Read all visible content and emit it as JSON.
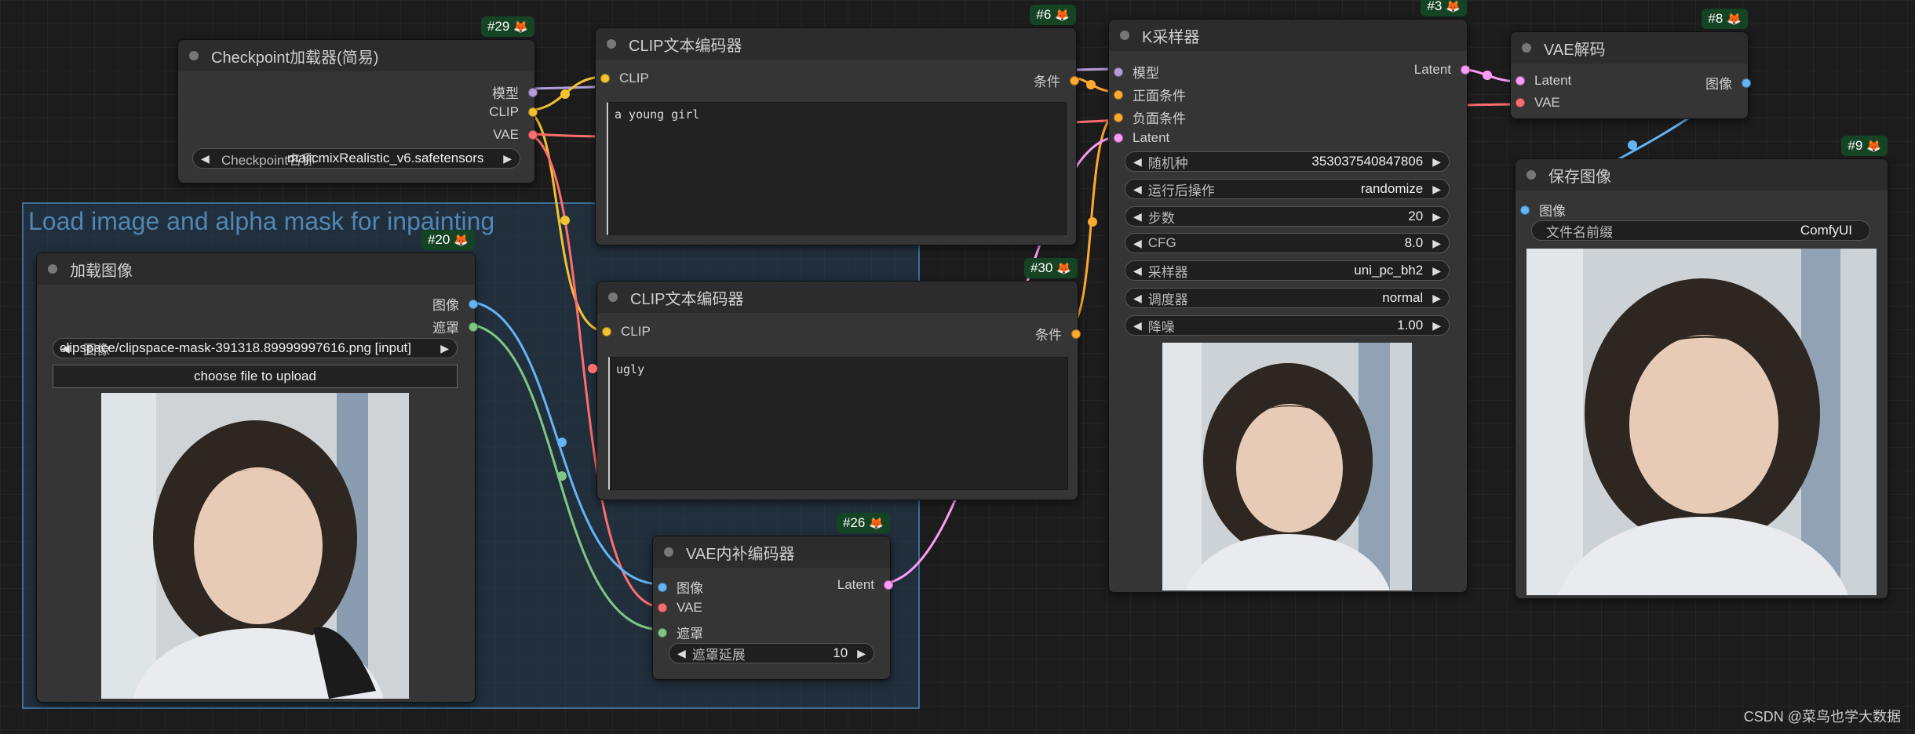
{
  "group": {
    "title": "Load image and alpha mask for inpainting"
  },
  "colors": {
    "model": "#b39ddb",
    "clip": "#f2c230",
    "vae": "#ff6e6e",
    "cond": "#ffa931",
    "latent": "#ff9cf9",
    "image": "#64b5f6",
    "mask": "#81c784"
  },
  "nodes": {
    "checkpoint": {
      "id": "#29",
      "title": "Checkpoint加载器(简易)",
      "outputs": [
        "模型",
        "CLIP",
        "VAE"
      ],
      "widget": {
        "label": "Checkpoint名称",
        "value": "majicmixRealistic_v6.safetensors"
      }
    },
    "clip_pos": {
      "id": "#6",
      "title": "CLIP文本编码器",
      "input": "CLIP",
      "output": "条件",
      "text": "a young girl"
    },
    "clip_neg": {
      "id": "#30",
      "title": "CLIP文本编码器",
      "input": "CLIP",
      "output": "条件",
      "text": "ugly"
    },
    "load_image": {
      "id": "#20",
      "title": "加载图像",
      "outputs": [
        "图像",
        "遮罩"
      ],
      "widget": {
        "label": "图像",
        "value": "clipspace/clipspace-mask-391318.89999997616.png [input]"
      },
      "upload_label": "choose file to upload"
    },
    "vae_inpaint": {
      "id": "#26",
      "title": "VAE内补编码器",
      "inputs": [
        "图像",
        "VAE",
        "遮罩"
      ],
      "output": "Latent",
      "widget": {
        "label": "遮罩延展",
        "value": "10"
      }
    },
    "ksampler": {
      "id": "#3",
      "title": "K采样器",
      "inputs": [
        "模型",
        "正面条件",
        "负面条件",
        "Latent"
      ],
      "output": "Latent",
      "widgets": [
        {
          "label": "随机种",
          "value": "353037540847806"
        },
        {
          "label": "运行后操作",
          "value": "randomize"
        },
        {
          "label": "步数",
          "value": "20"
        },
        {
          "label": "CFG",
          "value": "8.0"
        },
        {
          "label": "采样器",
          "value": "uni_pc_bh2"
        },
        {
          "label": "调度器",
          "value": "normal"
        },
        {
          "label": "降噪",
          "value": "1.00"
        }
      ]
    },
    "vae_decode": {
      "id": "#8",
      "title": "VAE解码",
      "inputs": [
        "Latent",
        "VAE"
      ],
      "output": "图像"
    },
    "save_image": {
      "id": "#9",
      "title": "保存图像",
      "input": "图像",
      "widget": {
        "label": "文件名前缀",
        "value": "ComfyUI"
      }
    }
  },
  "watermark": "CSDN @菜鸟也学大数据"
}
